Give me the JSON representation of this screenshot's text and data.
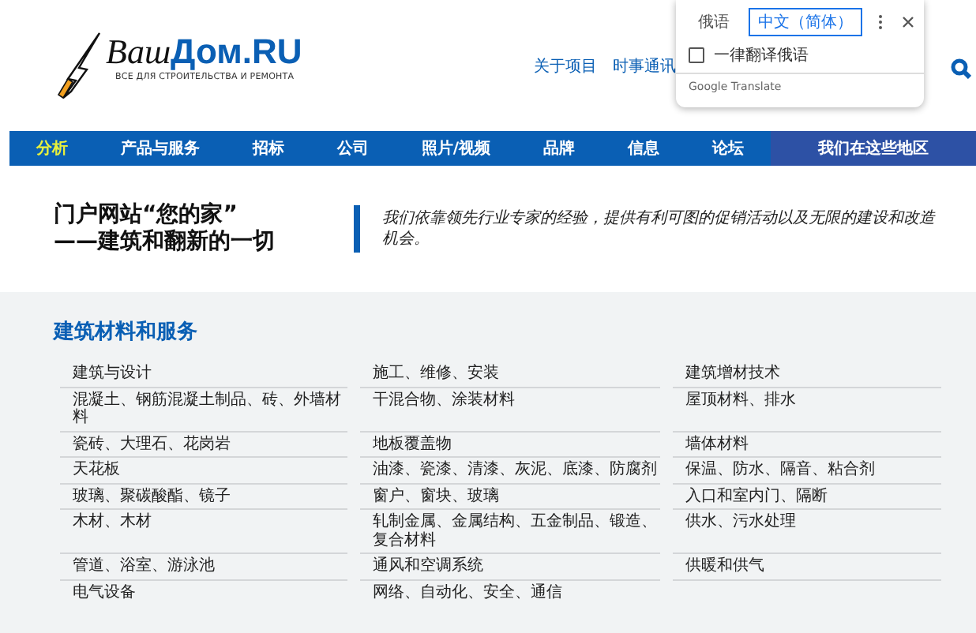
{
  "logo": {
    "word_1": "Ваш",
    "word_2": "Дом.RU",
    "tagline": "ВСЕ ДЛЯ СТРОИТЕЛЬСТВА И РЕМОНТА"
  },
  "header_links": [
    "关于项目",
    "时事通讯"
  ],
  "translate_popup": {
    "tabs": [
      {
        "label": "俄语",
        "selected": false
      },
      {
        "label": "中文（简体）",
        "selected": true
      }
    ],
    "always_translate": {
      "label": "一律翻译俄语",
      "checked": false
    },
    "footer": "Google Translate"
  },
  "nav": [
    {
      "label": "分析",
      "selected": true
    },
    {
      "label": "产品与服务",
      "selected": false
    },
    {
      "label": "招标",
      "selected": false
    },
    {
      "label": "公司",
      "selected": false
    },
    {
      "label": "照片/视频",
      "selected": false
    },
    {
      "label": "品牌",
      "selected": false
    },
    {
      "label": "信息",
      "selected": false
    },
    {
      "label": "论坛",
      "selected": false
    }
  ],
  "regions_button": "我们在这些地区",
  "hero": {
    "title_line_1": "门户网站“您的家”",
    "title_line_2": "——建筑和翻新的一切",
    "description": "我们依靠领先行业专家的经验，提供有利可图的促销活动以及无限的建设和改造机会。"
  },
  "catalog": {
    "title": "建筑材料和服务",
    "columns": [
      [
        "建筑与设计",
        "混凝土、钢筋混凝土制品、砖、外墙材料",
        "瓷砖、大理石、花岗岩",
        "天花板",
        "玻璃、聚碳酸酯、镜子",
        "木材、木材",
        "管道、浴室、游泳池",
        "电气设备"
      ],
      [
        "施工、维修、安装",
        "干混合物、涂装材料",
        "地板覆盖物",
        "油漆、瓷漆、清漆、灰泥、底漆、防腐剂",
        "窗户、窗块、玻璃",
        "轧制金属、金属结构、五金制品、锻造、复合材料",
        "通风和空调系统",
        "网络、自动化、安全、通信"
      ],
      [
        "建筑增材技术",
        "屋顶材料、排水",
        "墙体材料",
        "保温、防水、隔音、粘合剂",
        "入口和室内门、隔断",
        "供水、污水处理",
        "供暖和供气"
      ]
    ]
  }
}
